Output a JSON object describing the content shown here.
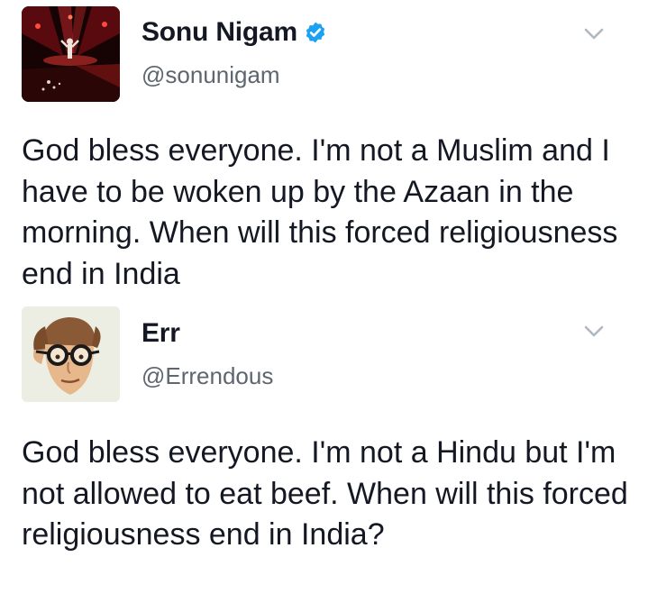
{
  "tweets": [
    {
      "author": {
        "display_name": "Sonu Nigam",
        "handle": "@sonunigam",
        "verified": true
      },
      "text": "God bless everyone. I'm not a Muslim and I have to be woken up by the Azaan in the morning. When will this forced religiousness end in India",
      "menu_icon": "chevron-down-icon"
    },
    {
      "author": {
        "display_name": "Err",
        "handle": "@Errendous",
        "verified": false
      },
      "text": "God bless everyone. I'm not a Hindu but I'm not allowed to eat beef. When will this forced religiousness end in India?",
      "menu_icon": "chevron-down-icon"
    }
  ],
  "colors": {
    "text": "#141823",
    "secondary_text": "#5e666e",
    "verified_badge": "#1da1f2",
    "chevron": "#b0b8bf"
  }
}
